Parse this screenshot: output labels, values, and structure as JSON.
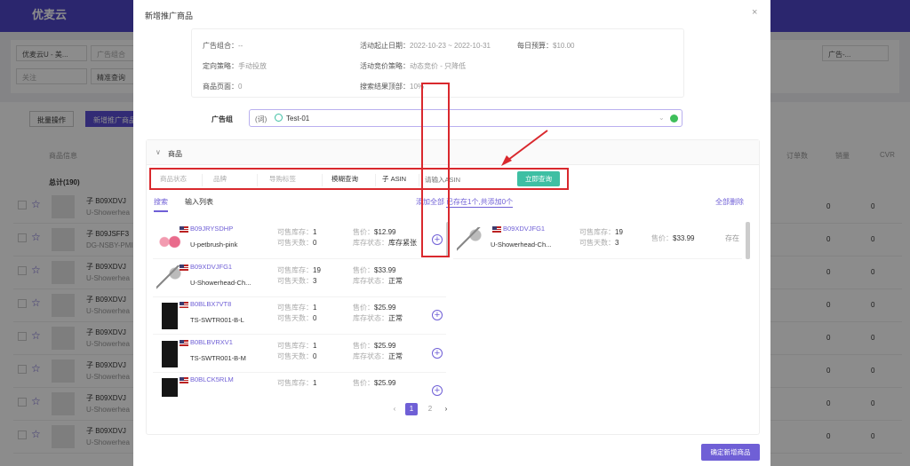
{
  "background": {
    "app_name": "优麦云",
    "account_select": "优麦云U - 美...",
    "portfolio_select": "广告组合",
    "follow_select": "关注",
    "match_select": "精准查询",
    "right_select": "广告-...",
    "batch_button": "批量操作",
    "new_button": "新增推广商品",
    "col_product": "商品信息",
    "col_orders": "订单数",
    "col_sales": "销量",
    "col_cvr": "CVR",
    "total_label": "总计(190)",
    "rows": [
      {
        "asin": "子 B09XDVJ",
        "sku": "U-Showerhea",
        "orders": "0",
        "sales": "0"
      },
      {
        "asin": "子 B09JSFF3",
        "sku": "DG-NSBY-PMI",
        "orders": "0",
        "sales": "0"
      },
      {
        "asin": "子 B09XDVJ",
        "sku": "U-Showerhea",
        "orders": "0",
        "sales": "0"
      },
      {
        "asin": "子 B09XDVJ",
        "sku": "U-Showerhea",
        "orders": "0",
        "sales": "0"
      },
      {
        "asin": "子 B09XDVJ",
        "sku": "U-Showerhea",
        "orders": "0",
        "sales": "0"
      },
      {
        "asin": "子 B09XDVJ",
        "sku": "U-Showerhea",
        "orders": "0",
        "sales": "0"
      },
      {
        "asin": "子 B09XDVJ",
        "sku": "U-Showerhea",
        "orders": "0",
        "sales": "0"
      },
      {
        "asin": "子 B09XDVJ",
        "sku": "U-Showerhea",
        "orders": "0",
        "sales": "0"
      }
    ]
  },
  "modal": {
    "title": "新增推广商品",
    "close": "×",
    "info": {
      "portfolio_label": "广告组合：",
      "portfolio_value": "--",
      "date_label": "活动起止日期：",
      "date_value": "2022-10-23 ~ 2022-10-31",
      "budget_label": "每日预算：",
      "budget_value": "$10.00",
      "targeting_label": "定向策略：",
      "targeting_value": "手动投放",
      "bidding_label": "活动竞价策略：",
      "bidding_value": "动态竞价 - 只降低",
      "product_page_label": "商品页面：",
      "product_page_value": "0",
      "top_search_label": "搜索结果顶部：",
      "top_search_value": "10%"
    },
    "ad_group_label": "广告组",
    "ad_group_value": "(词)",
    "ad_group_name": "Test-01",
    "products_section": "商品",
    "filters": {
      "status": "商品状态",
      "brand": "品牌",
      "tag": "导购标签",
      "match": "模糊查询",
      "asin_type": "子 ASIN",
      "asin_placeholder": "请输入ASIN",
      "query_button": "立即查询"
    },
    "tabs": [
      "搜索",
      "输入列表"
    ],
    "add_all": "添加全部",
    "summary": "已存在1个,共添加0个",
    "delete_all": "全部删除",
    "labels": {
      "stock": "可售库存：",
      "days": "可售天数：",
      "price": "售价：",
      "stock_status": "库存状态："
    },
    "products": [
      {
        "asin": "B09JRYSDHP",
        "sku": "U-petbrush-pink",
        "stock": "1",
        "days": "0",
        "price": "$12.99",
        "status": "库存紧张",
        "img": "pink"
      },
      {
        "asin": "B09XDVJFG1",
        "sku": "U-Showerhead-Ch...",
        "stock": "19",
        "days": "3",
        "price": "$33.99",
        "status": "正常",
        "img": "shower"
      },
      {
        "asin": "B0BLBX7VT8",
        "sku": "TS-SWTR001-B-L",
        "stock": "1",
        "days": "0",
        "price": "$25.99",
        "status": "正常",
        "img": "sweater"
      },
      {
        "asin": "B0BLBVRXV1",
        "sku": "TS-SWTR001-B-M",
        "stock": "1",
        "days": "0",
        "price": "$25.99",
        "status": "正常",
        "img": "sweater"
      },
      {
        "asin": "B0BLCK5RLM",
        "sku": "",
        "stock": "1",
        "days": "",
        "price": "$25.99",
        "status": "",
        "img": "sweater"
      }
    ],
    "selected": [
      {
        "asin": "B09XDVJFG1",
        "sku": "U-Showerhead-Ch...",
        "stock": "19",
        "days": "3",
        "price": "$33.99",
        "state": "存在"
      }
    ],
    "pagination": {
      "prev": "‹",
      "pages": [
        "1",
        "2"
      ],
      "next": "›",
      "current": "1"
    },
    "confirm_button": "确定新增商品"
  },
  "colors": {
    "accent": "#6f5fd6",
    "query": "#3ebfa3",
    "highlight": "#d9282d"
  }
}
